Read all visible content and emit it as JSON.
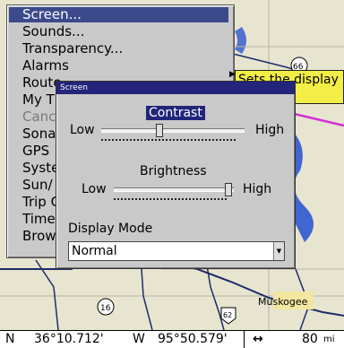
{
  "menu": {
    "items": [
      {
        "label": "Screen...",
        "state": "selected"
      },
      {
        "label": "Sounds...",
        "state": "normal"
      },
      {
        "label": "Transparency...",
        "state": "normal"
      },
      {
        "label": "Alarms",
        "state": "normal"
      },
      {
        "label": "Route",
        "state": "normal"
      },
      {
        "label": "My T",
        "state": "normal"
      },
      {
        "label": "Canc",
        "state": "disabled"
      },
      {
        "label": "Sona",
        "state": "normal"
      },
      {
        "label": "GPS",
        "state": "normal"
      },
      {
        "label": "Syste",
        "state": "normal"
      },
      {
        "label": "Sun/",
        "state": "normal"
      },
      {
        "label": "Trip C",
        "state": "normal"
      },
      {
        "label": "Timer",
        "state": "normal"
      },
      {
        "label": "Brow",
        "state": "normal"
      }
    ]
  },
  "tooltip": {
    "text_line1": "Sets the display",
    "text_line2": "contrast."
  },
  "dialog": {
    "title": "Screen",
    "contrast": {
      "label": "Contrast",
      "low": "Low",
      "high": "High",
      "level": 0.4
    },
    "brightness": {
      "label": "Brightness",
      "low": "Low",
      "high": "High",
      "level": 0.95
    },
    "display_mode": {
      "label": "Display Mode",
      "value": "Normal"
    }
  },
  "map": {
    "labels": {
      "city": "Muskogee",
      "route_66": "66",
      "route_16": "16",
      "route_62": "62"
    }
  },
  "status": {
    "lat_hemi": "N",
    "lat": "36°10.712'",
    "lon_hemi": "W",
    "lon": "95°50.579'",
    "zoom_arrow": "↔",
    "zoom": "80",
    "zoom_unit": "mi"
  },
  "colors": {
    "menu_bg": "#c9c9c9",
    "highlight": "#3c4a8c",
    "dialog_title": "#22257a",
    "tooltip_bg": "#f2ee45"
  }
}
